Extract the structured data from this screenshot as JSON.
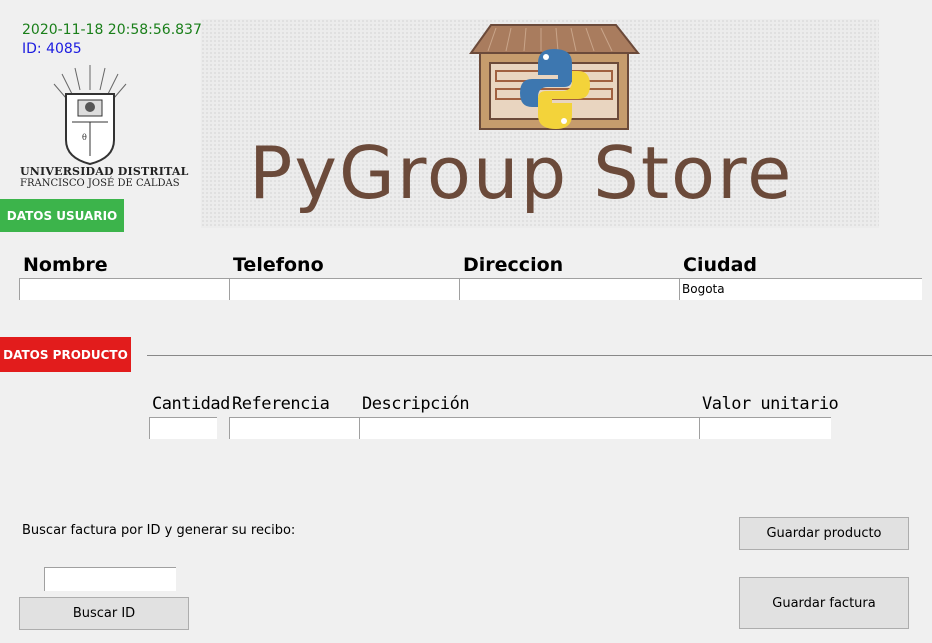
{
  "header": {
    "timestamp": "2020-11-18 20:58:56.83795",
    "id_label": "ID: 4085"
  },
  "university": {
    "name": "UNIVERSIDAD DISTRITAL",
    "subtitle": "FRANCISCO JOSÉ DE CALDAS"
  },
  "banner": {
    "title": "PyGroup Store"
  },
  "sections": {
    "user_badge": "DATOS USUARIO",
    "product_badge": "DATOS PRODUCTO"
  },
  "user_form": {
    "headers": [
      "Nombre",
      "Telefono",
      "Direccion",
      "Ciudad"
    ],
    "values": [
      "",
      "",
      "",
      "Bogota"
    ]
  },
  "product_form": {
    "headers": [
      "Cantidad",
      "Referencia",
      "Descripción",
      "Valor unitario"
    ],
    "values": [
      "",
      "",
      "",
      ""
    ]
  },
  "search": {
    "label": "Buscar factura por ID y generar su recibo:",
    "value": "",
    "button": "Buscar ID"
  },
  "actions": {
    "save_product": "Guardar producto",
    "save_invoice": "Guardar factura"
  },
  "colors": {
    "user_badge": "#3cb44b",
    "product_badge": "#e21c1c",
    "timestamp": "#1a7f1a",
    "id": "#1c1ce0"
  }
}
